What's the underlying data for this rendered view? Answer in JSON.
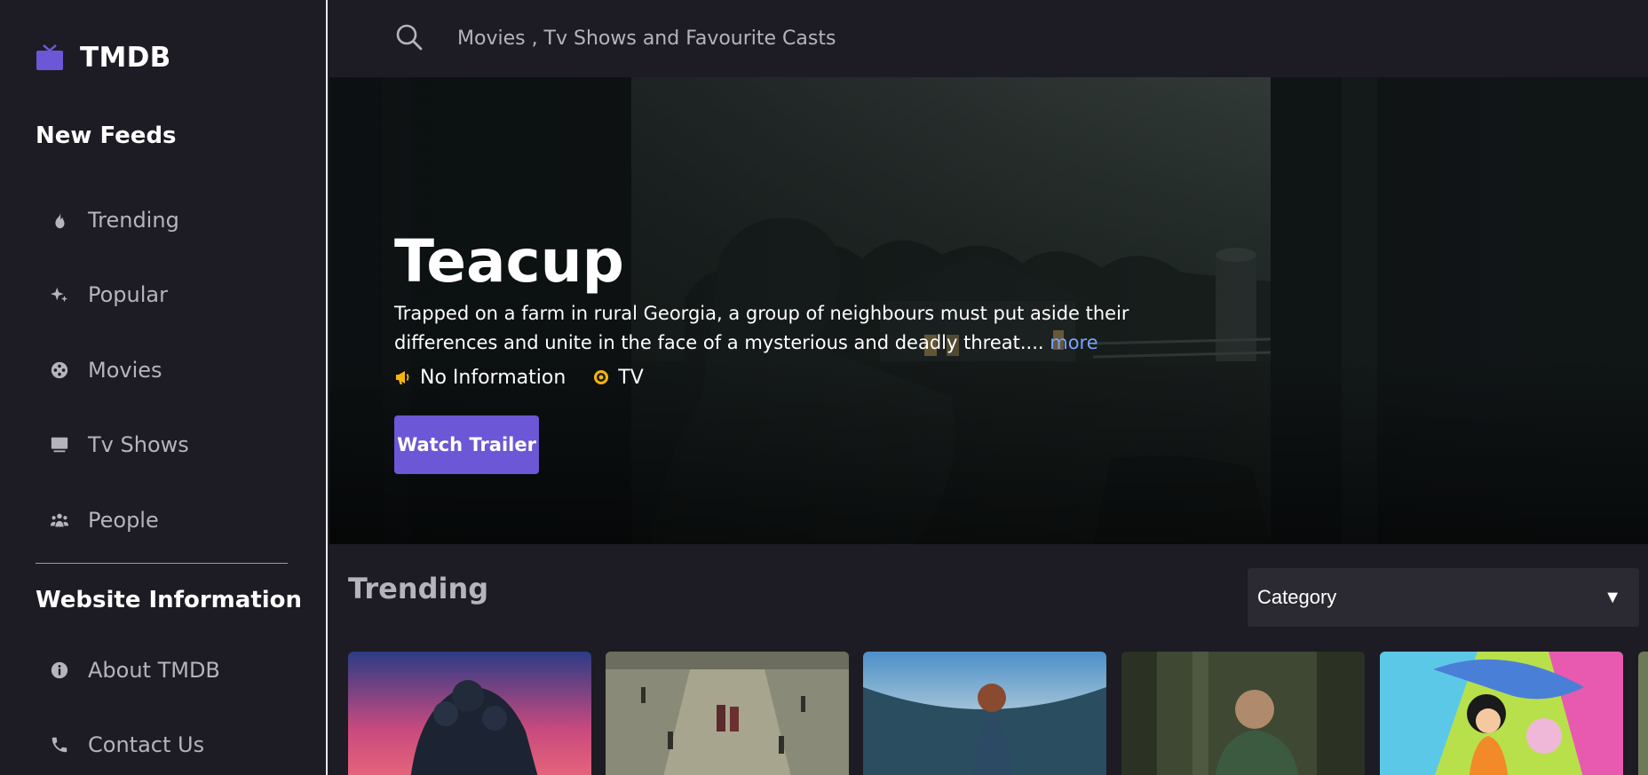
{
  "brand": {
    "name": "TMDB",
    "icon": "tv-icon",
    "accent": "#6c57d6"
  },
  "sidebar": {
    "feeds_title": "New Feeds",
    "feeds": [
      {
        "label": "Trending",
        "icon": "fire-icon"
      },
      {
        "label": "Popular",
        "icon": "sparkle-icon"
      },
      {
        "label": "Movies",
        "icon": "film-reel-icon"
      },
      {
        "label": "Tv Shows",
        "icon": "tv-screen-icon"
      },
      {
        "label": "People",
        "icon": "people-icon"
      }
    ],
    "info_title": "Website Information",
    "info": [
      {
        "label": "About TMDB",
        "icon": "info-icon"
      },
      {
        "label": "Contact Us",
        "icon": "phone-icon"
      }
    ]
  },
  "search": {
    "placeholder": "Movies , Tv Shows and Favourite Casts",
    "value": ""
  },
  "hero": {
    "title": "Teacup",
    "description": "Trapped on a farm in rural Georgia, a group of neighbours must put aside their differences and unite in the face of a mysterious and deadly threat....",
    "more_label": "more",
    "meta": [
      {
        "label": "No Information",
        "icon": "megaphone-icon",
        "color": "#f5b50a"
      },
      {
        "label": "TV",
        "icon": "disc-icon",
        "color": "#f5b50a"
      }
    ],
    "button_label": "Watch Trailer"
  },
  "trending": {
    "title": "Trending",
    "category_label": "Category",
    "cards": [
      {
        "name": "trending-card-1"
      },
      {
        "name": "trending-card-2"
      },
      {
        "name": "trending-card-3"
      },
      {
        "name": "trending-card-4"
      },
      {
        "name": "trending-card-5"
      }
    ]
  }
}
